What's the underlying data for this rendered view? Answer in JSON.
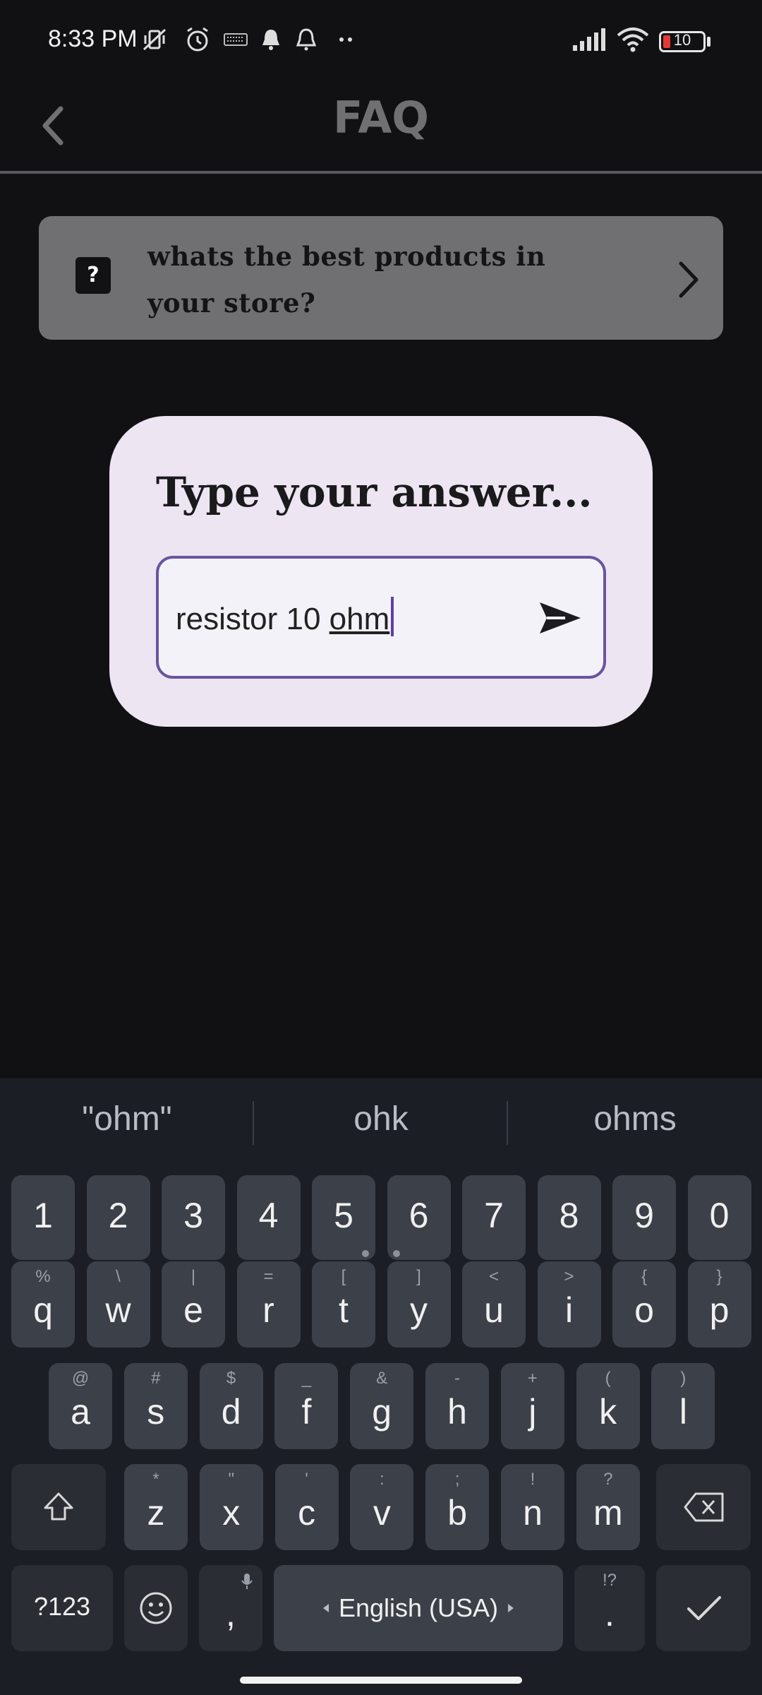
{
  "status_bar": {
    "time": "8:33 PM",
    "battery": "10",
    "icons": [
      "mute-vibrate-icon",
      "alarm-icon",
      "keyboard-icon",
      "bell-icon",
      "bell-outline-icon",
      "more-dots-icon",
      "signal-icon",
      "wifi-icon",
      "battery-icon"
    ]
  },
  "app_bar": {
    "title": "FAQ",
    "back_icon": "chevron-left-icon"
  },
  "faq": {
    "question": "whats the best products in your store?",
    "question_icon": "?",
    "chevron_icon": "chevron-right-icon"
  },
  "dialog": {
    "title": "Type your answer...",
    "input_prefix": "resistor 10 ",
    "input_composing": "ohm",
    "send_icon": "send-icon"
  },
  "keyboard": {
    "suggestions": [
      "\"ohm\"",
      "ohk",
      "ohms"
    ],
    "numbers": [
      "1",
      "2",
      "3",
      "4",
      "5",
      "6",
      "7",
      "8",
      "9",
      "0"
    ],
    "row1": [
      {
        "key": "q",
        "hint": "%"
      },
      {
        "key": "w",
        "hint": "\\"
      },
      {
        "key": "e",
        "hint": "|"
      },
      {
        "key": "r",
        "hint": "="
      },
      {
        "key": "t",
        "hint": "["
      },
      {
        "key": "y",
        "hint": "]"
      },
      {
        "key": "u",
        "hint": "<"
      },
      {
        "key": "i",
        "hint": ">"
      },
      {
        "key": "o",
        "hint": "{"
      },
      {
        "key": "p",
        "hint": "}"
      }
    ],
    "row2": [
      {
        "key": "a",
        "hint": "@"
      },
      {
        "key": "s",
        "hint": "#"
      },
      {
        "key": "d",
        "hint": "$"
      },
      {
        "key": "f",
        "hint": "_"
      },
      {
        "key": "g",
        "hint": "&"
      },
      {
        "key": "h",
        "hint": "-"
      },
      {
        "key": "j",
        "hint": "+"
      },
      {
        "key": "k",
        "hint": "("
      },
      {
        "key": "l",
        "hint": ")"
      }
    ],
    "row3": [
      {
        "key": "z",
        "hint": "*"
      },
      {
        "key": "x",
        "hint": "\""
      },
      {
        "key": "c",
        "hint": "'"
      },
      {
        "key": "v",
        "hint": ":"
      },
      {
        "key": "b",
        "hint": ";"
      },
      {
        "key": "n",
        "hint": "!"
      },
      {
        "key": "m",
        "hint": "?"
      }
    ],
    "symbols_key": "?123",
    "comma_key": ",",
    "space_label": "English (USA)",
    "period_key": ".",
    "period_hint": "!?",
    "colors": {
      "key": "#3c4048",
      "key_dark": "#2a2d34",
      "background": "#1b1e24"
    }
  },
  "colors": {
    "background": "#111114",
    "card": "#707072",
    "dialog": "#ede5f2",
    "accent": "#6a55a0"
  }
}
